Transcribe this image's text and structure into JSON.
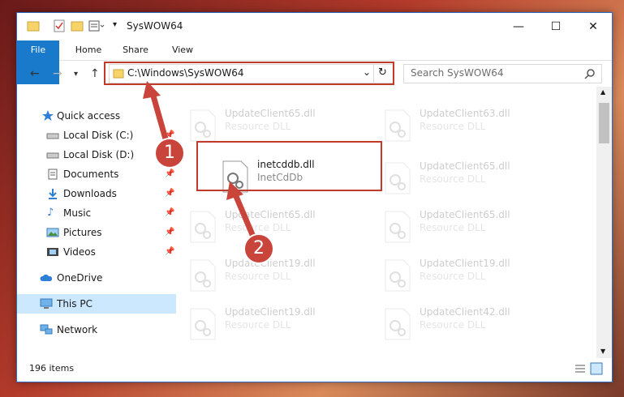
{
  "window": {
    "title": "SysWOW64"
  },
  "ribbon": {
    "tabs": [
      "File",
      "Home",
      "Share",
      "View"
    ]
  },
  "address": {
    "path": "C:\\Windows\\SysWOW64"
  },
  "search": {
    "placeholder": "Search SysWOW64"
  },
  "sidebar": {
    "items": [
      {
        "label": "Quick access"
      },
      {
        "label": "Local Disk (C:)"
      },
      {
        "label": "Local Disk (D:)"
      },
      {
        "label": "Documents"
      },
      {
        "label": "Downloads"
      },
      {
        "label": "Music"
      },
      {
        "label": "Pictures"
      },
      {
        "label": "Videos"
      },
      {
        "label": "OneDrive"
      },
      {
        "label": "This PC"
      },
      {
        "label": "Network"
      }
    ]
  },
  "files": [
    {
      "name": "UpdateClient65.dll",
      "desc": "Resource DLL"
    },
    {
      "name": "UpdateClient63.dll",
      "desc": "Resource DLL"
    },
    {
      "name": "inetcddb.dll",
      "desc": "InetCdDb"
    },
    {
      "name": "UpdateClient65.dll",
      "desc": "Resource DLL"
    },
    {
      "name": "UpdateClient65.dll",
      "desc": "Resource DLL"
    },
    {
      "name": "UpdateClient65.dll",
      "desc": "Resource DLL"
    },
    {
      "name": "UpdateClient19.dll",
      "desc": "Resource DLL"
    },
    {
      "name": "UpdateClient19.dll",
      "desc": "Resource DLL"
    },
    {
      "name": "UpdateClient19.dll",
      "desc": "Resource DLL"
    },
    {
      "name": "UpdateClient42.dll",
      "desc": "Resource DLL"
    }
  ],
  "status": {
    "count": "196 items"
  },
  "annotations": {
    "step1": "1",
    "step2": "2"
  }
}
